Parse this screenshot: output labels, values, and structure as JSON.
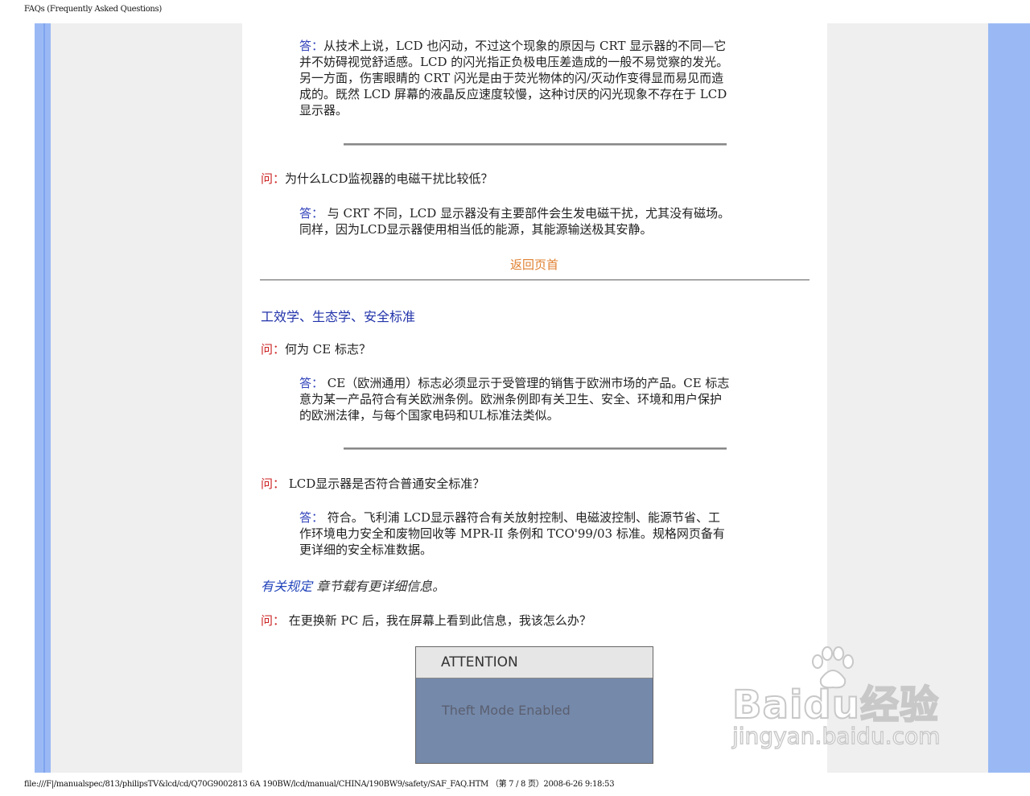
{
  "header": "FAQs (Frequently Asked Questions)",
  "footer": "file:///F|/manualspec/813/philipsTV&lcd/cd/Q70G9002813 6A 190BW/lcd/manual/CHINA/190BW9/safety/SAF_FAQ.HTM （第 7 / 8 页）2008-6-26 9:18:53",
  "q_label": "问：",
  "a_label": "答：",
  "answer1_lines": [
    "从技术上说，LCD 也闪动，不过这个现象的原因与 CRT 显示器的不同—它",
    "并不妨碍视觉舒适感。LCD 的闪光指正负极电压差造成的一般不易觉察的发光。",
    "另一方面，伤害眼睛的 CRT 闪光是由于荧光物体的闪/灭动作变得显而易见而造",
    "成的。既然 LCD 屏幕的液晶反应速度较慢，这种讨厌的闪光现象不存在于 LCD",
    "显示器。"
  ],
  "question2": "为什么LCD监视器的电磁干扰比较低？",
  "answer2_lines": [
    " 与 CRT 不同，LCD 显示器没有主要部件会生发电磁干扰，尤其没有磁场。",
    "同样，因为LCD显示器使用相当低的能源，其能源输送极其安静。"
  ],
  "back_to_top": "返回页首",
  "section_title": "工效学、生态学、安全标准",
  "question3": "何为 CE 标志？",
  "answer3_lines": [
    " CE（欧洲通用）标志必须显示于受管理的销售于欧洲市场的产品。CE 标志",
    "意为某一产品符合有关欧洲条例。欧洲条例即有关卫生、安全、环境和用户保护",
    "的欧洲法律，与每个国家电码和UL标准法类似。"
  ],
  "question4": " LCD显示器是否符合普通安全标准？",
  "answer4_lines": [
    " 符合。飞利浦 LCD显示器符合有关放射控制、电磁波控制、能源节省、工",
    "作环境电力安全和废物回收等 MPR-II 条例和 TCO'99/03 标准。规格网页备有",
    "更详细的安全标准数据。"
  ],
  "regulatory_link": "有关规定",
  "regulatory_suffix": " 章节载有更详细信息。",
  "question5": " 在更换新 PC 后，我在屏幕上看到此信息，我该怎么办？",
  "attention_title": "ATTENTION",
  "attention_message": "Theft Mode Enabled",
  "watermark_word": "Baidu经验",
  "watermark_url": "jingyan.baidu.com"
}
